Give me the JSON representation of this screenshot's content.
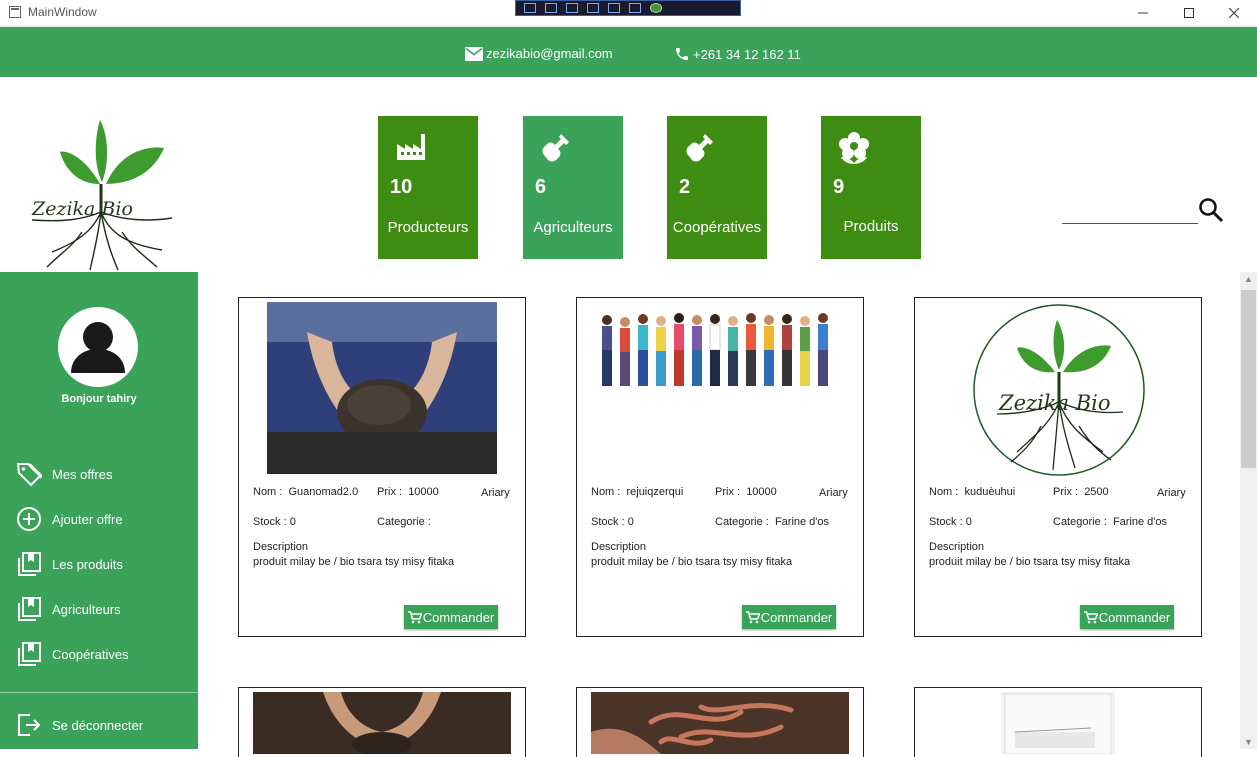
{
  "window": {
    "title": "MainWindow"
  },
  "contact": {
    "email": "zezikabio@gmail.com",
    "phone": "+261 34 12 162 11"
  },
  "logo": {
    "text": "Zezika Bio"
  },
  "stats": [
    {
      "icon": "factory-icon",
      "value": "10",
      "label": "Producteurs"
    },
    {
      "icon": "shovel-icon",
      "value": "6",
      "label": "Agriculteurs"
    },
    {
      "icon": "shovel-icon",
      "value": "2",
      "label": "Coopératives"
    },
    {
      "icon": "flower-icon",
      "value": "9",
      "label": "Produits"
    }
  ],
  "search": {
    "value": ""
  },
  "sidebar": {
    "greeting": "Bonjour tahiry",
    "items": [
      {
        "label": "Mes offres",
        "icon": "tag-icon"
      },
      {
        "label": "Ajouter offre",
        "icon": "plus-circle-icon"
      },
      {
        "label": "Les produits",
        "icon": "library-icon"
      },
      {
        "label": "Agriculteurs",
        "icon": "library-icon"
      },
      {
        "label": "Coopératives",
        "icon": "library-icon"
      }
    ],
    "logout": "Se déconnecter"
  },
  "labels": {
    "nom": "Nom :",
    "prix": "Prix :",
    "currency": "Ariary",
    "stock": "Stock :",
    "categorie": "Categorie :",
    "description": "Description",
    "order": "Commander"
  },
  "products": [
    {
      "image": "soil-hands-image",
      "name": "Guanomad2.0",
      "price": "10000",
      "stock": "0",
      "category": "",
      "description": "produit milay be / bio tsara tsy misy fitaka"
    },
    {
      "image": "people-crowd-image",
      "name": "rejuiqzerqui",
      "price": "10000",
      "stock": "0",
      "category": "Farine d'os",
      "description": "produit milay be / bio tsara tsy misy fitaka"
    },
    {
      "image": "zezika-bio-logo-image",
      "name": "kuduèuhui",
      "price": "2500",
      "stock": "0",
      "category": "Farine d'os",
      "description": "produit milay be / bio tsara tsy misy fitaka"
    }
  ],
  "colors": {
    "accent": "#3aa359",
    "tile_dark": "#3e8c12",
    "white": "#ffffff"
  }
}
